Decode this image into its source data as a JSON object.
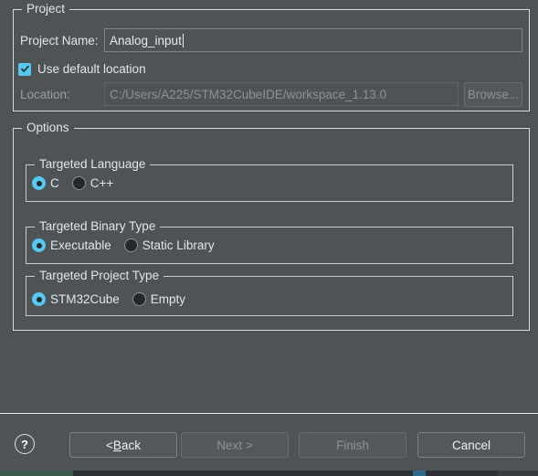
{
  "dialog": {
    "background_color": "#4e5456",
    "accent_color": "#57c8f2",
    "border_color": "#d7dadb"
  },
  "project_group": {
    "label": "Project",
    "project_name_label": "Project Name:",
    "project_name_value": "Analog_input",
    "use_default_location": {
      "label": "Use default location",
      "checked": true,
      "icon": "check-icon"
    },
    "location_label": "Location:",
    "location_value": "C:/Users/A225/STM32CubeIDE/workspace_1.13.0",
    "location_enabled": false,
    "browse_button": {
      "label": "Browse...",
      "enabled": false
    }
  },
  "options_group": {
    "label": "Options",
    "targeted_language": {
      "label": "Targeted Language",
      "options": [
        {
          "label": "C",
          "selected": true
        },
        {
          "label": "C++",
          "selected": false
        }
      ]
    },
    "targeted_binary_type": {
      "label": "Targeted Binary Type",
      "options": [
        {
          "label": "Executable",
          "selected": true
        },
        {
          "label": "Static Library",
          "selected": false
        }
      ]
    },
    "targeted_project_type": {
      "label": "Targeted Project Type",
      "options": [
        {
          "label": "STM32Cube",
          "selected": true
        },
        {
          "label": "Empty",
          "selected": false
        }
      ]
    }
  },
  "footer": {
    "help_icon": "question-mark-icon",
    "help_glyph": "?",
    "buttons": [
      {
        "name": "back",
        "prefix": "< ",
        "mnemonic": "B",
        "suffix": "ack",
        "label": "< Back",
        "enabled": true
      },
      {
        "name": "next",
        "label": "Next >",
        "enabled": false
      },
      {
        "name": "finish",
        "label": "Finish",
        "enabled": false
      },
      {
        "name": "cancel",
        "label": "Cancel",
        "enabled": true
      }
    ]
  }
}
